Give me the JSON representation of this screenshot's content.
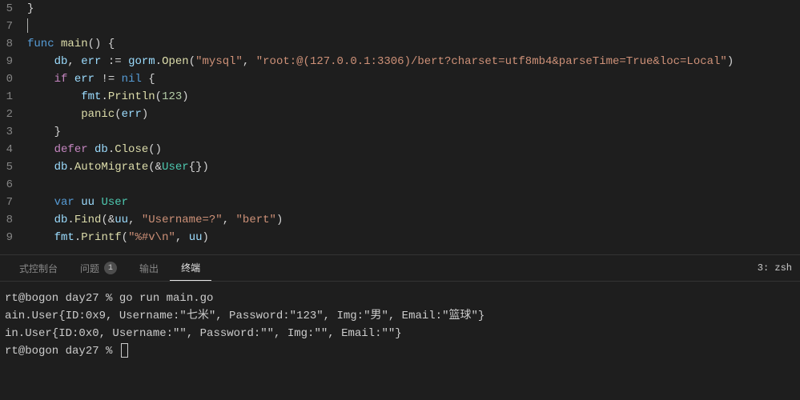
{
  "editor": {
    "gutter": [
      "5",
      "7",
      "8",
      "9",
      "0",
      "1",
      "2",
      "3",
      "4",
      "5",
      "6",
      "7",
      "8",
      "9"
    ],
    "lines": [
      [
        {
          "t": "punc",
          "v": "}"
        }
      ],
      [],
      [
        {
          "t": "keyword",
          "v": "func"
        },
        {
          "t": "plain",
          "v": " "
        },
        {
          "t": "func",
          "v": "main"
        },
        {
          "t": "punc",
          "v": "() {"
        }
      ],
      [
        {
          "t": "plain",
          "v": "    "
        },
        {
          "t": "ident",
          "v": "db"
        },
        {
          "t": "punc",
          "v": ", "
        },
        {
          "t": "ident",
          "v": "err"
        },
        {
          "t": "plain",
          "v": " "
        },
        {
          "t": "punc",
          "v": ":= "
        },
        {
          "t": "ident",
          "v": "gorm"
        },
        {
          "t": "punc",
          "v": "."
        },
        {
          "t": "func",
          "v": "Open"
        },
        {
          "t": "punc",
          "v": "("
        },
        {
          "t": "string",
          "v": "\"mysql\""
        },
        {
          "t": "punc",
          "v": ", "
        },
        {
          "t": "string",
          "v": "\"root:@(127.0.0.1:3306)/bert?charset=utf8mb4&parseTime=True&loc=Local\""
        },
        {
          "t": "punc",
          "v": ")"
        }
      ],
      [
        {
          "t": "plain",
          "v": "    "
        },
        {
          "t": "keyword2",
          "v": "if"
        },
        {
          "t": "plain",
          "v": " "
        },
        {
          "t": "ident",
          "v": "err"
        },
        {
          "t": "plain",
          "v": " "
        },
        {
          "t": "punc",
          "v": "!= "
        },
        {
          "t": "keyword",
          "v": "nil"
        },
        {
          "t": "plain",
          "v": " "
        },
        {
          "t": "punc",
          "v": "{"
        }
      ],
      [
        {
          "t": "plain",
          "v": "        "
        },
        {
          "t": "ident",
          "v": "fmt"
        },
        {
          "t": "punc",
          "v": "."
        },
        {
          "t": "func",
          "v": "Println"
        },
        {
          "t": "punc",
          "v": "("
        },
        {
          "t": "number",
          "v": "123"
        },
        {
          "t": "punc",
          "v": ")"
        }
      ],
      [
        {
          "t": "plain",
          "v": "        "
        },
        {
          "t": "func",
          "v": "panic"
        },
        {
          "t": "punc",
          "v": "("
        },
        {
          "t": "ident",
          "v": "err"
        },
        {
          "t": "punc",
          "v": ")"
        }
      ],
      [
        {
          "t": "plain",
          "v": "    "
        },
        {
          "t": "punc",
          "v": "}"
        }
      ],
      [
        {
          "t": "plain",
          "v": "    "
        },
        {
          "t": "keyword2",
          "v": "defer"
        },
        {
          "t": "plain",
          "v": " "
        },
        {
          "t": "ident",
          "v": "db"
        },
        {
          "t": "punc",
          "v": "."
        },
        {
          "t": "func",
          "v": "Close"
        },
        {
          "t": "punc",
          "v": "()"
        }
      ],
      [
        {
          "t": "plain",
          "v": "    "
        },
        {
          "t": "ident",
          "v": "db"
        },
        {
          "t": "punc",
          "v": "."
        },
        {
          "t": "func",
          "v": "AutoMigrate"
        },
        {
          "t": "punc",
          "v": "(&"
        },
        {
          "t": "type",
          "v": "User"
        },
        {
          "t": "punc",
          "v": "{})"
        }
      ],
      [],
      [
        {
          "t": "plain",
          "v": "    "
        },
        {
          "t": "keyword",
          "v": "var"
        },
        {
          "t": "plain",
          "v": " "
        },
        {
          "t": "ident",
          "v": "uu"
        },
        {
          "t": "plain",
          "v": " "
        },
        {
          "t": "type",
          "v": "User"
        }
      ],
      [
        {
          "t": "plain",
          "v": "    "
        },
        {
          "t": "ident",
          "v": "db"
        },
        {
          "t": "punc",
          "v": "."
        },
        {
          "t": "func",
          "v": "Find"
        },
        {
          "t": "punc",
          "v": "(&"
        },
        {
          "t": "ident",
          "v": "uu"
        },
        {
          "t": "punc",
          "v": ", "
        },
        {
          "t": "string",
          "v": "\"Username=?\""
        },
        {
          "t": "punc",
          "v": ", "
        },
        {
          "t": "string",
          "v": "\"bert\""
        },
        {
          "t": "punc",
          "v": ")"
        }
      ],
      [
        {
          "t": "plain",
          "v": "    "
        },
        {
          "t": "ident",
          "v": "fmt"
        },
        {
          "t": "punc",
          "v": "."
        },
        {
          "t": "func",
          "v": "Printf"
        },
        {
          "t": "punc",
          "v": "("
        },
        {
          "t": "string",
          "v": "\"%#v\\n\""
        },
        {
          "t": "punc",
          "v": ", "
        },
        {
          "t": "ident",
          "v": "uu"
        },
        {
          "t": "punc",
          "v": ")"
        }
      ]
    ]
  },
  "panel": {
    "tabs": {
      "debug": "式控制台",
      "problems": "问题",
      "problems_count": "1",
      "output": "输出",
      "terminal": "终端"
    },
    "terminal_picker": "3: zsh"
  },
  "terminal": {
    "lines": [
      "rt@bogon day27 % go run main.go",
      "ain.User{ID:0x9, Username:\"七米\", Password:\"123\", Img:\"男\", Email:\"篮球\"}",
      "in.User{ID:0x0, Username:\"\", Password:\"\", Img:\"\", Email:\"\"}",
      "rt@bogon day27 % "
    ]
  }
}
